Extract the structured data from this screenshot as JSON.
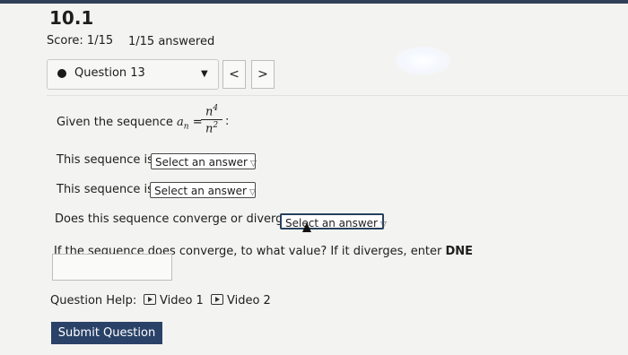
{
  "header": {
    "title": "10.1",
    "score": "Score: 1/15",
    "answered": "1/15 answered"
  },
  "question_nav": {
    "current": "Question 13",
    "prev_glyph": "<",
    "next_glyph": ">"
  },
  "question": {
    "given_text": "Given the sequence",
    "sequence_symbol": "a",
    "sequence_subscript": "n",
    "equals": "=",
    "numerator": "n",
    "numerator_exp": "4",
    "denominator": "n",
    "denominator_exp": "2",
    "colon": ":",
    "line1_label": "This sequence is",
    "line1_select": "Select an answer",
    "line2_label": "This sequence is",
    "line2_select": "Select an answer",
    "line3_label": "Does this sequence converge or diverge?",
    "line3_select": "Select an answer",
    "line4_prefix": "If the sequence does converge, to what value? If it diverges, enter ",
    "line4_dne": "DNE",
    "answer_value": ""
  },
  "help": {
    "label": "Question Help:",
    "video1": "Video 1",
    "video2": "Video 2"
  },
  "submit_label": "Submit Question"
}
